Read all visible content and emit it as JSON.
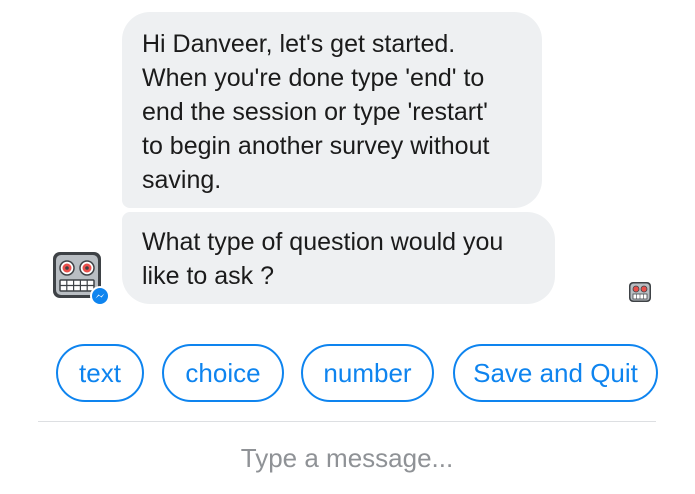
{
  "conversation": {
    "messages": [
      {
        "lines": [
          "Hi Danveer, let's get started.",
          "When you're done type 'end' to",
          "end the session or type 'restart'",
          "to begin another survey without",
          "saving."
        ]
      },
      {
        "lines": [
          "What type of question would you",
          "like to ask ?"
        ]
      }
    ],
    "bot_avatar_icon": "robot-face-icon",
    "messenger_badge_icon": "messenger-badge-icon",
    "read_receipt_icon": "robot-face-icon"
  },
  "quick_replies": [
    {
      "label": "text"
    },
    {
      "label": "choice"
    },
    {
      "label": "number"
    },
    {
      "label": "Save and Quit"
    }
  ],
  "composer": {
    "placeholder": "Type a message..."
  },
  "colors": {
    "accent": "#0e84ef",
    "bubble_bg": "#eef0f2",
    "text": "#1b1b1b",
    "placeholder": "#8f9296",
    "divider": "#dddfe2"
  }
}
